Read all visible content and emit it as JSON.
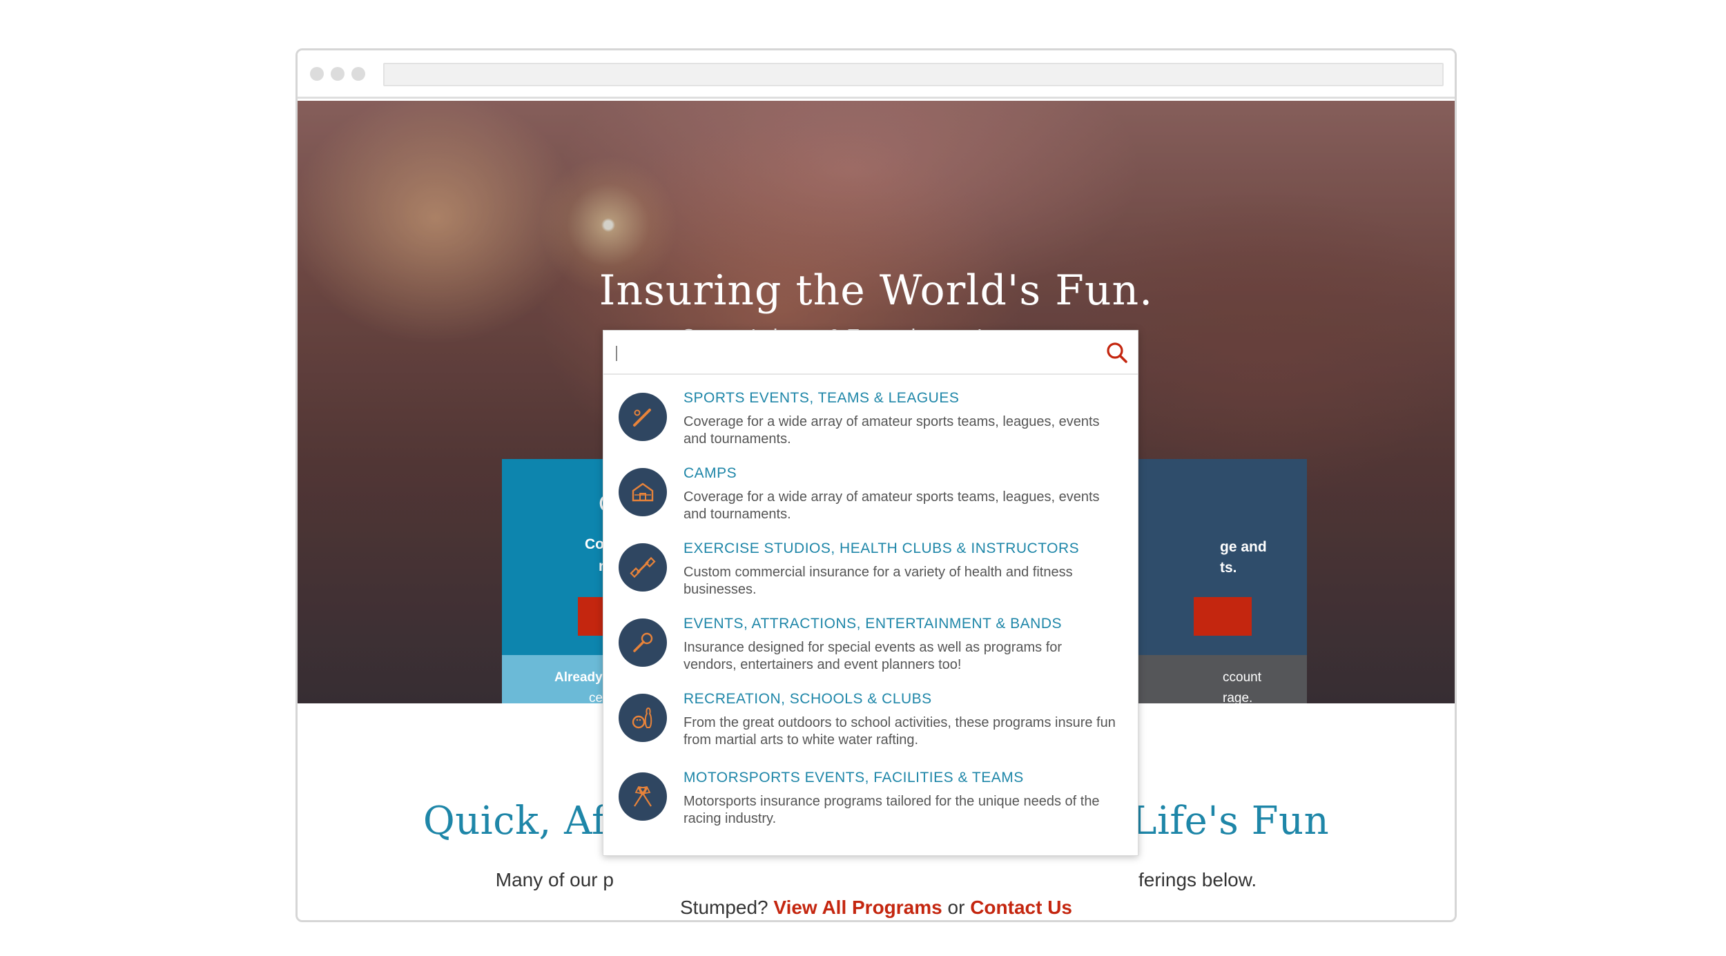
{
  "hero": {
    "title": "Insuring the World's Fun.",
    "subtitle": "Sports, Leisure, & Entertainment Insurance."
  },
  "cards": {
    "left_heading_fragment": "C",
    "left_text_1": "Cov",
    "left_text_2": "n",
    "left_foot_1": "Already",
    "left_foot_2": "cer",
    "right_text_1": "ge and",
    "right_text_2": "ts.",
    "right_foot_1": "ccount",
    "right_foot_2": "rage."
  },
  "search": {
    "placeholder": "",
    "value": ""
  },
  "results": [
    {
      "title": "SPORTS EVENTS, TEAMS & LEAGUES",
      "desc": "Coverage for a wide array of amateur sports teams, leagues, events and tournaments.",
      "icon": "baseball-bat-icon"
    },
    {
      "title": "CAMPS",
      "desc": "Coverage for a wide array of amateur sports teams, leagues, events and tournaments.",
      "icon": "cabin-icon"
    },
    {
      "title": "EXERCISE STUDIOS, HEALTH CLUBS & INSTRUCTORS",
      "desc": "Custom commercial insurance for a variety of health and fitness businesses.",
      "icon": "dumbbell-icon"
    },
    {
      "title": "EVENTS, ATTRACTIONS, ENTERTAINMENT & BANDS",
      "desc": "Insurance designed for special events as well as programs for vendors, entertainers and event planners too!",
      "icon": "microphone-icon"
    },
    {
      "title": "RECREATION, SCHOOLS & CLUBS",
      "desc": "From the great outdoors to school activities, these programs insure fun from martial arts to white water rafting.",
      "icon": "bowling-icon"
    },
    {
      "title": "MOTORSPORTS EVENTS, FACILITIES & TEAMS",
      "desc": "Motorsports insurance programs tailored for the unique needs of the racing industry.",
      "icon": "checkered-flags-icon"
    }
  ],
  "below": {
    "title_left": "Quick, Af",
    "title_right": "Life's Fun",
    "sub_left": "Many of our p",
    "sub_right": "ferings below.",
    "links_prefix": "Stumped?",
    "link_programs": "View All Programs",
    "links_or": "or",
    "link_contact": "Contact Us"
  },
  "colors": {
    "accent_teal": "#1e86a8",
    "accent_red": "#c4260f",
    "icon_navy": "#2f4661",
    "icon_orange": "#e8833a"
  }
}
